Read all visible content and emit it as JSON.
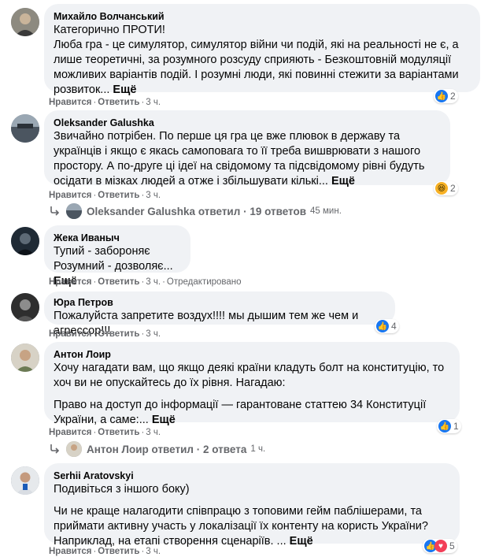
{
  "comments": [
    {
      "author": "Михайло Волчанський",
      "lines": [
        "Категорично ПРОТИ!",
        "Люба гра - це симулятор, симулятор війни чи подій, які на реальності не є, а лише теоретичні, за розумного розсуду сприяють - Безкоштовній модуляції можливих варіантів подій. І розумні люди, які повинні стежити за варіантами розвиток..."
      ],
      "more": "Ещё",
      "like": "Нравится",
      "reply": "Ответить",
      "time": "3 ч.",
      "reaction_count": "2",
      "reactions": [
        "like-reaction-icon"
      ]
    },
    {
      "author": "Oleksander Galushka",
      "lines": [
        "Звичайно потрібен. По перше ця гра це вже плювок в державу та українців і якщо є якась самоповага то її треба вишврювати з нашого простору. А по-друге ці ідеї на свідомому та підсвідомому рівні будуть осідати в мізках людей а отже і збільшувати кількі..."
      ],
      "more": "Ещё",
      "like": "Нравится",
      "reply": "Ответить",
      "time": "3 ч.",
      "reaction_count": "2",
      "reactions": [
        "haha-reaction-icon"
      ],
      "replies": {
        "author": "Oleksander Galushka",
        "verb": "ответил",
        "count": "19 ответов",
        "time": "45 мин."
      }
    },
    {
      "author": "Жека Иваныч",
      "lines": [
        "Тупий - забороняє",
        "Розумний - дозволяє..."
      ],
      "more": "Ещё",
      "like": "Нравится",
      "reply": "Ответить",
      "time": "3 ч.",
      "edited": "Отредактировано"
    },
    {
      "author": "Юра Петров",
      "lines": [
        "Пожалуйста запретите воздух!!!! мы дышим тем же чем и агрессор!!!"
      ],
      "like": "Нравится",
      "reply": "Ответить",
      "time": "3 ч.",
      "reaction_count": "4",
      "reactions": [
        "like-reaction-icon"
      ]
    },
    {
      "author": "Антон Лоир",
      "paragraphs": [
        "Хочу нагадати вам, що якщо деякі країни кладуть болт на конституцію, то хоч ви не опускайтесь до їх рівня. Нагадаю:",
        "Право на доступ до інформації — гарантоване статтею 34 Конституції України, а саме:..."
      ],
      "more": "Ещё",
      "like": "Нравится",
      "reply": "Ответить",
      "time": "3 ч.",
      "reaction_count": "1",
      "reactions": [
        "like-reaction-icon"
      ],
      "replies": {
        "author": "Антон Лоир",
        "verb": "ответил",
        "count": "2 ответа",
        "time": "1 ч."
      }
    },
    {
      "author": "Serhii Aratovskyi",
      "paragraphs": [
        "Подивіться з іншого боку)",
        "Чи не краще налагодити співпрацю з топовими гейм паблішерами, та приймати активну участь у локалізації їх контенту на користь України? Наприклад, на етапі створення сценаріїв. ..."
      ],
      "more": "Ещё",
      "like": "Нравится",
      "reply": "Ответить",
      "time": "3 ч.",
      "reaction_count": "5",
      "reactions": [
        "like-reaction-icon",
        "love-reaction-icon"
      ]
    }
  ],
  "colors": {
    "bubble": "#f0f2f5",
    "meta": "#65676b",
    "like": "#1877f2",
    "love": "#f33e58",
    "haha": "#f7b125"
  }
}
